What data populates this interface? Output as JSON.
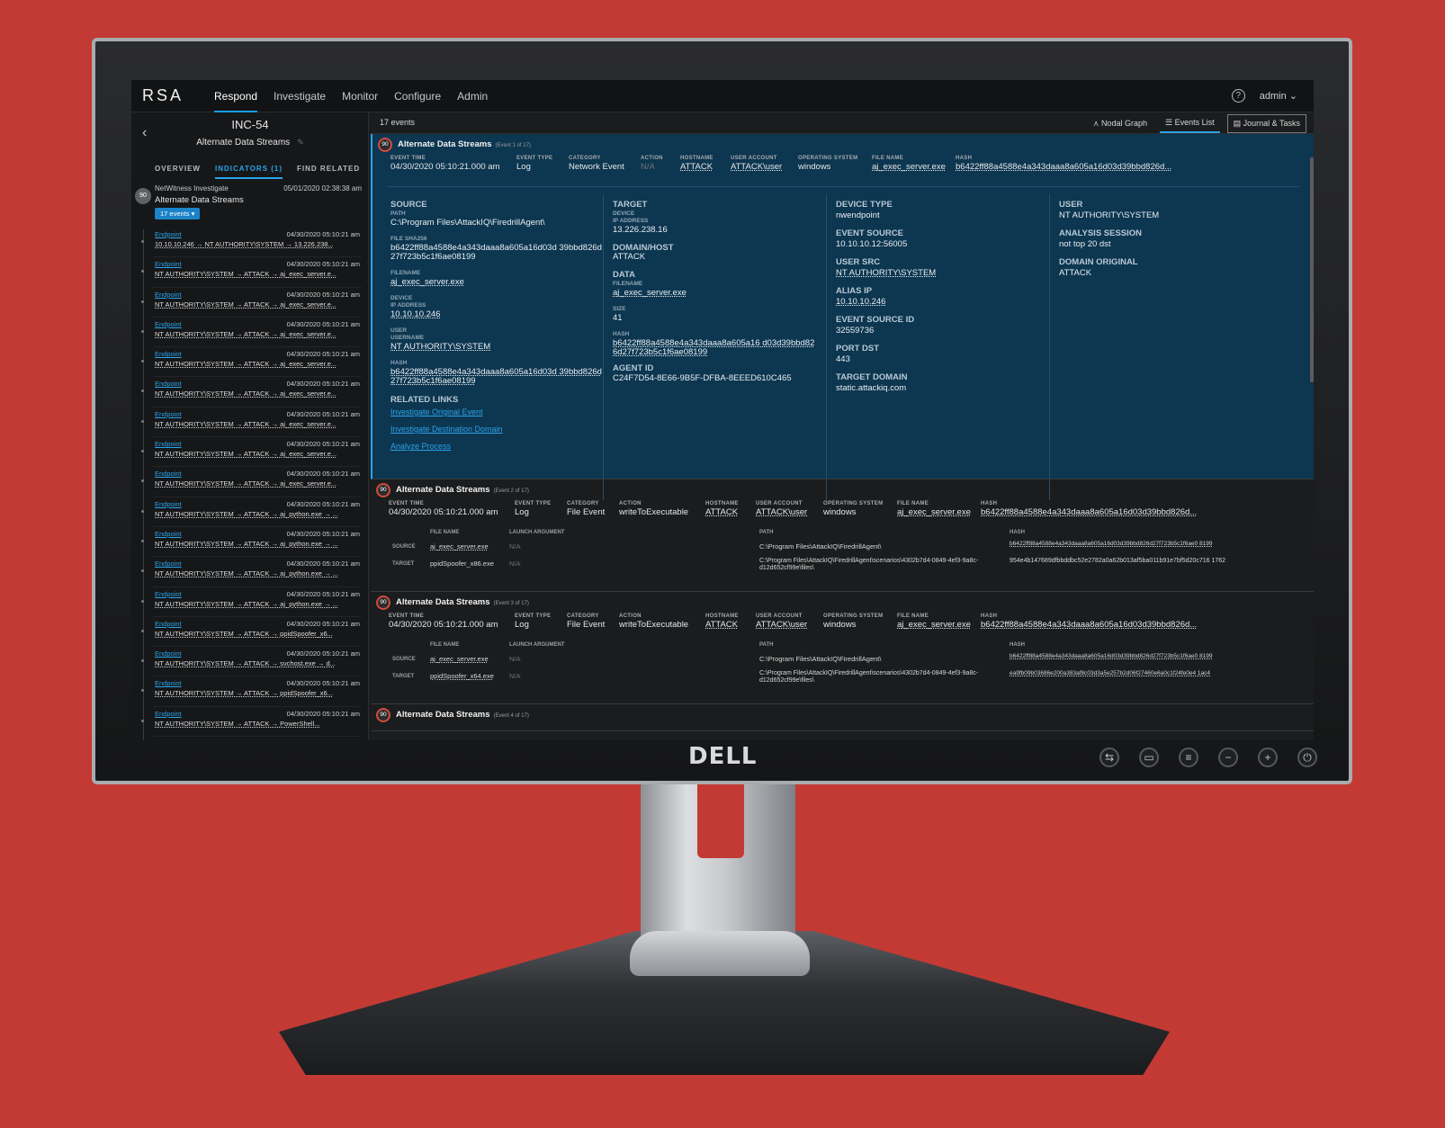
{
  "brand": "RSA",
  "nav": [
    "Respond",
    "Investigate",
    "Monitor",
    "Configure",
    "Admin"
  ],
  "user": "admin",
  "incident": {
    "id": "INC-54",
    "name": "Alternate Data Streams"
  },
  "left_tabs": [
    "OVERVIEW",
    "INDICATORS (1)",
    "FIND RELATED"
  ],
  "indicator": {
    "score": "90",
    "source": "NetWitness Investigate",
    "date": "05/01/2020 02:38:38 am",
    "title": "Alternate Data Streams",
    "events_badge": "17 events"
  },
  "left_events": [
    {
      "type": "Endpoint",
      "time": "04/30/2020 05:10:21 am",
      "line": "10.10.10.246  → NT AUTHORITY\\SYSTEM → 13.226.238..."
    },
    {
      "type": "Endpoint",
      "time": "04/30/2020 05:10:21 am",
      "line": "NT AUTHORITY\\SYSTEM → ATTACK  → aj_exec_server.e..."
    },
    {
      "type": "Endpoint",
      "time": "04/30/2020 05:10:21 am",
      "line": "NT AUTHORITY\\SYSTEM → ATTACK  → aj_exec_server.e..."
    },
    {
      "type": "Endpoint",
      "time": "04/30/2020 05:10:21 am",
      "line": "NT AUTHORITY\\SYSTEM → ATTACK  → aj_exec_server.e..."
    },
    {
      "type": "Endpoint",
      "time": "04/30/2020 05:10:21 am",
      "line": "NT AUTHORITY\\SYSTEM → ATTACK  → aj_exec_server.e..."
    },
    {
      "type": "Endpoint",
      "time": "04/30/2020 05:10:21 am",
      "line": "NT AUTHORITY\\SYSTEM → ATTACK  → aj_exec_server.e..."
    },
    {
      "type": "Endpoint",
      "time": "04/30/2020 05:10:21 am",
      "line": "NT AUTHORITY\\SYSTEM → ATTACK  → aj_exec_server.e..."
    },
    {
      "type": "Endpoint",
      "time": "04/30/2020 05:10:21 am",
      "line": "NT AUTHORITY\\SYSTEM → ATTACK  → aj_exec_server.e..."
    },
    {
      "type": "Endpoint",
      "time": "04/30/2020 05:10:21 am",
      "line": "NT AUTHORITY\\SYSTEM → ATTACK  → aj_exec_server.e..."
    },
    {
      "type": "Endpoint",
      "time": "04/30/2020 05:10:21 am",
      "line": "NT AUTHORITY\\SYSTEM → ATTACK  → aj_python.exe  → ..."
    },
    {
      "type": "Endpoint",
      "time": "04/30/2020 05:10:21 am",
      "line": "NT AUTHORITY\\SYSTEM → ATTACK  → aj_python.exe  → ..."
    },
    {
      "type": "Endpoint",
      "time": "04/30/2020 05:10:21 am",
      "line": "NT AUTHORITY\\SYSTEM → ATTACK  → aj_python.exe  → ..."
    },
    {
      "type": "Endpoint",
      "time": "04/30/2020 05:10:21 am",
      "line": "NT AUTHORITY\\SYSTEM → ATTACK  → aj_python.exe  → ..."
    },
    {
      "type": "Endpoint",
      "time": "04/30/2020 05:10:21 am",
      "line": "NT AUTHORITY\\SYSTEM → ATTACK  → ppidSpoofer_x6..."
    },
    {
      "type": "Endpoint",
      "time": "04/30/2020 05:10:21 am",
      "line": "NT AUTHORITY\\SYSTEM → ATTACK  → svchost.exe  → d..."
    },
    {
      "type": "Endpoint",
      "time": "04/30/2020 05:10:21 am",
      "line": "NT AUTHORITY\\SYSTEM → ATTACK  → ppidSpoofer_x6..."
    },
    {
      "type": "Endpoint",
      "time": "04/30/2020 05:10:21 am",
      "line": "NT AUTHORITY\\SYSTEM → ATTACK  → PowerShell..."
    }
  ],
  "main": {
    "count": "17 events",
    "views": [
      "Nodal Graph",
      "Events List",
      "Journal & Tasks"
    ]
  },
  "events": [
    {
      "score": "90",
      "title": "Alternate Data Streams",
      "sub": "(Event 1 of 17)",
      "meta": {
        "event_time": "04/30/2020 05:10:21.000 am",
        "event_type": "Log",
        "category": "Network Event",
        "action": "N/A",
        "hostname": "ATTACK",
        "user_account": "ATTACK\\user",
        "os": "windows",
        "file_name": "aj_exec_server.exe",
        "hash": "b6422ff88a4588e4a343daaa8a605a16d03d39bbd826d..."
      },
      "source": {
        "heading": "SOURCE",
        "path": "C:\\Program Files\\AttackIQ\\FiredrillAgent\\",
        "file_sha256": "b6422ff88a4588e4a343daaa8a605a16d03d 39bbd826d27f723b5c1f6ae08199",
        "filename": "aj_exec_server.exe",
        "ip": "10.10.10.246",
        "username": "NT AUTHORITY\\SYSTEM",
        "hash": "b6422ff88a4588e4a343daaa8a605a16d03d 39bbd826d27f723b5c1f6ae08199"
      },
      "target": {
        "heading": "TARGET",
        "ip": "13.226.238.16",
        "domain_host": "ATTACK",
        "filename": "aj_exec_server.exe",
        "size": "41",
        "hash": "b6422ff88a4588e4a343daaa8a605a16 d03d39bbd826d27f723b5c1f6ae08199",
        "agent_id": "C24F7D54-8E66-9B5F-DFBA-8EEED610C465"
      },
      "device": {
        "device_type": "nwendpoint",
        "event_source": "10.10.10.12:56005",
        "user_src": "NT AUTHORITY\\SYSTEM",
        "alias_ip": "10.10.10.246",
        "event_source_id": "32559736",
        "port_dst": "443",
        "target_domain": "static.attackiq.com"
      },
      "user": {
        "user": "NT AUTHORITY\\SYSTEM",
        "analysis_session": "not top 20 dst",
        "domain_original": "ATTACK"
      },
      "links": {
        "heading": "RELATED LINKS",
        "items": [
          "Investigate Original Event",
          "Investigate Destination Domain",
          "Analyze Process"
        ]
      }
    },
    {
      "score": "90",
      "title": "Alternate Data Streams",
      "sub": "(Event 2 of 17)",
      "meta": {
        "event_time": "04/30/2020 05:10:21.000 am",
        "event_type": "Log",
        "category": "File Event",
        "action": "writeToExecutable",
        "hostname": "ATTACK",
        "user_account": "ATTACK\\user",
        "os": "windows",
        "file_name": "aj_exec_server.exe",
        "hash": "b6422ff88a4588e4a343daaa8a605a16d03d39bbd826d..."
      },
      "source": {
        "filename": "aj_exec_server.exe",
        "launch": "N/A",
        "path": "C:\\Program Files\\AttackIQ\\FiredrillAgent\\",
        "hash": "b6422ff88a4588e4a343daaa8a605a16d03d39bbd826d27f723b5c1f6ae0 8199"
      },
      "target": {
        "filename": "ppidSpoofer_x86.exe",
        "launch": "N/A",
        "path": "C:\\Program Files\\AttackIQ\\FiredrillAgent\\scenarios\\4302b7d4-0849-4ef3-9a8c-d12d652cf99e\\files\\",
        "hash": "954e4b147689dfbbddbc52e2782a0a62b013af5ba011b91e7bf5d20c716 1762"
      }
    },
    {
      "score": "90",
      "title": "Alternate Data Streams",
      "sub": "(Event 3 of 17)",
      "meta": {
        "event_time": "04/30/2020 05:10:21.000 am",
        "event_type": "Log",
        "category": "File Event",
        "action": "writeToExecutable",
        "hostname": "ATTACK",
        "user_account": "ATTACK\\user",
        "os": "windows",
        "file_name": "aj_exec_server.exe",
        "hash": "b6422ff88a4588e4a343daaa8a605a16d03d39bbd826d..."
      },
      "source": {
        "filename": "aj_exec_server.exe",
        "launch": "N/A",
        "path": "C:\\Program Files\\AttackIQ\\FiredrillAgent\\",
        "hash": "b6422ff88a4588e4a343daaa8a605a16d03d39bbd826d27f723b5c1f6ae0 8199"
      },
      "target": {
        "filename": "ppidSpoofer_x64.exe",
        "launch": "N/A",
        "path": "C:\\Program Files\\AttackIQ\\FiredrillAgent\\scenarios\\4302b7d4-0849-4ef3-9a8c-d12d652cf99e\\files\\",
        "hash": "ea9fb09b03686e200a383af8c03d3a5e257b2d06f27460e6a0c1f24fe0e4 1ac4"
      }
    },
    {
      "score": "90",
      "title": "Alternate Data Streams",
      "sub": "(Event 4 of 17)"
    }
  ],
  "labels": {
    "event_time": "EVENT TIME",
    "event_type": "EVENT TYPE",
    "category": "CATEGORY",
    "action": "ACTION",
    "hostname": "HOSTNAME",
    "user_account": "USER ACCOUNT",
    "os": "OPERATING SYSTEM",
    "file_name": "FILE NAME",
    "hash": "HASH",
    "path": "PATH",
    "file_sha256": "FILE SHA256",
    "filename": "FILENAME",
    "device": "DEVICE",
    "ip_address": "IP ADDRESS",
    "user": "USER",
    "username": "USERNAME",
    "domain_host": "DOMAIN/HOST",
    "data": "DATA",
    "size": "SIZE",
    "agent_id": "AGENT ID",
    "device_type": "DEVICE TYPE",
    "event_source": "EVENT SOURCE",
    "user_src": "USER SRC",
    "alias_ip": "ALIAS IP",
    "event_source_id": "EVENT SOURCE ID",
    "port_dst": "PORT DST",
    "target_domain": "TARGET DOMAIN",
    "analysis_session": "ANALYSIS SESSION",
    "domain_original": "DOMAIN ORIGINAL",
    "launch_argument": "LAUNCH ARGUMENT",
    "source_row": "SOURCE",
    "target_row": "TARGET"
  },
  "monitor": {
    "logo": "DELL"
  }
}
